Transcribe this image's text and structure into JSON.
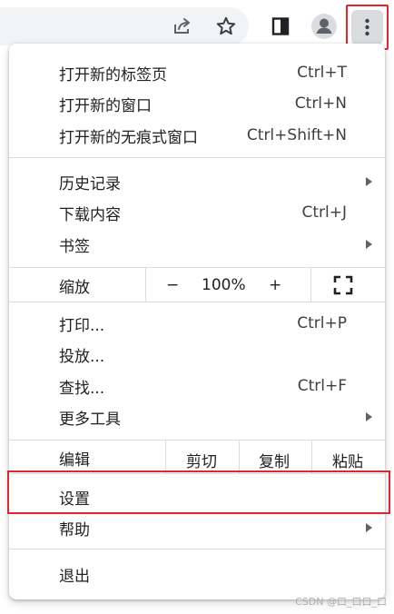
{
  "toolbar": {
    "icons": [
      "share-icon",
      "bookmark-star-icon",
      "side-panel-icon",
      "profile-avatar-icon",
      "kebab-menu-icon"
    ]
  },
  "menu": {
    "group1": [
      {
        "label": "打开新的标签页",
        "shortcut": "Ctrl+T"
      },
      {
        "label": "打开新的窗口",
        "shortcut": "Ctrl+N"
      },
      {
        "label": "打开新的无痕式窗口",
        "shortcut": "Ctrl+Shift+N"
      }
    ],
    "group2": [
      {
        "label": "历史记录",
        "submenu": true
      },
      {
        "label": "下载内容",
        "shortcut": "Ctrl+J"
      },
      {
        "label": "书签",
        "submenu": true
      }
    ],
    "zoom": {
      "label": "缩放",
      "minus": "−",
      "value": "100%",
      "plus": "+"
    },
    "group3": [
      {
        "label": "打印...",
        "shortcut": "Ctrl+P"
      },
      {
        "label": "投放..."
      },
      {
        "label": "查找...",
        "shortcut": "Ctrl+F"
      },
      {
        "label": "更多工具",
        "submenu": true
      }
    ],
    "edit": {
      "label": "编辑",
      "cut": "剪切",
      "copy": "复制",
      "paste": "粘贴"
    },
    "group4": [
      {
        "label": "设置"
      },
      {
        "label": "帮助",
        "submenu": true
      }
    ],
    "exit": {
      "label": "退出"
    }
  },
  "watermark": "CSDN @口_口口_口",
  "colors": {
    "highlight": "#e0262f",
    "separator": "#dadce0"
  }
}
